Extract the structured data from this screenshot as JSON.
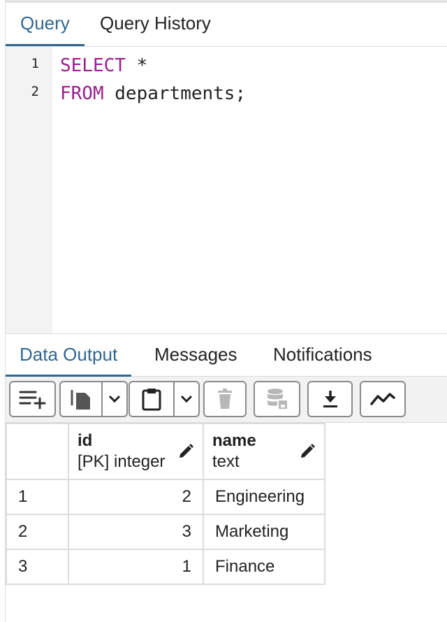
{
  "tabs": {
    "query": "Query",
    "history": "Query History"
  },
  "editor": {
    "lines": [
      {
        "num": "1",
        "keyword": "SELECT",
        "rest": " *"
      },
      {
        "num": "2",
        "keyword": "FROM",
        "rest": " departments;"
      }
    ]
  },
  "output_tabs": {
    "data_output": "Data Output",
    "messages": "Messages",
    "notifications": "Notifications"
  },
  "toolbar": {
    "icons": [
      "add-row-icon",
      "copy-icon",
      "chevron-down-icon",
      "paste-icon",
      "chevron-down-icon",
      "delete-icon",
      "save-data-icon",
      "download-icon",
      "graph-icon"
    ]
  },
  "grid": {
    "columns": [
      {
        "name": "id",
        "type": "[PK] integer"
      },
      {
        "name": "name",
        "type": "text"
      }
    ],
    "rows": [
      {
        "num": "1",
        "id": "2",
        "name": "Engineering"
      },
      {
        "num": "2",
        "id": "3",
        "name": "Marketing"
      },
      {
        "num": "3",
        "id": "1",
        "name": "Finance"
      }
    ]
  },
  "colors": {
    "accent": "#326690",
    "keyword": "#9a1f8d"
  }
}
